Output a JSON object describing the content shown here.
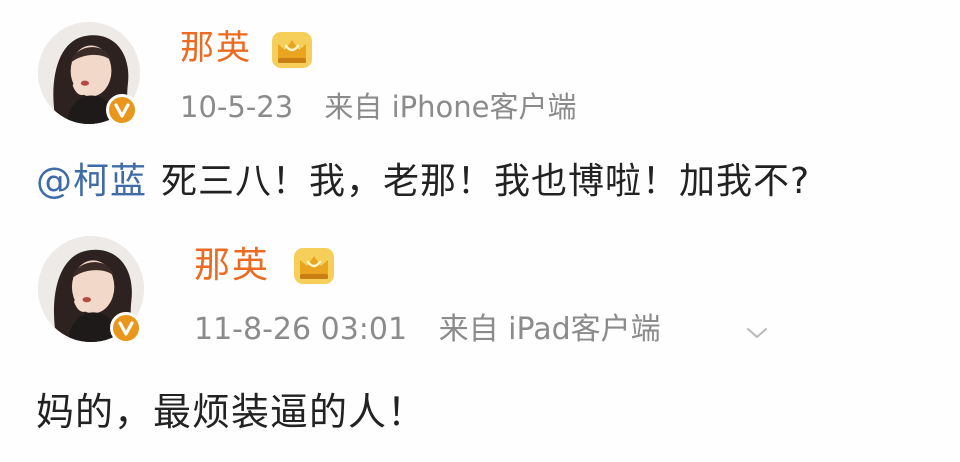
{
  "posts": [
    {
      "author": "那英",
      "meta_time": "10-5-23",
      "meta_source": "来自 iPhone客户端",
      "mention": "@柯蓝",
      "content": "死三八！我，老那！我也博啦！加我不?",
      "avatar_icon": "avatar-photo",
      "badge_icon": "verified-v-icon",
      "crown_icon": "crown-icon"
    },
    {
      "author": "那英",
      "meta_time": "11-8-26 03:01",
      "meta_source": "来自 iPad客户端",
      "content": "妈的，最烦装逼的人！",
      "avatar_icon": "avatar-photo",
      "badge_icon": "verified-v-icon",
      "crown_icon": "crown-icon",
      "menu_icon": "chevron-down-icon"
    }
  ],
  "colors": {
    "name": "#eb6b22",
    "meta": "#8b8b8b",
    "mention": "#3f6ba8",
    "text": "#222222",
    "badge": "#e8961c",
    "crown": "#f0b72f"
  }
}
